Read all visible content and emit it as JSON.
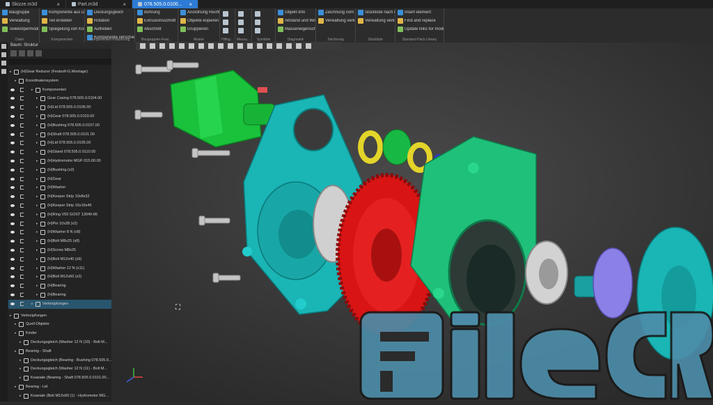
{
  "tabs": [
    {
      "label": "Skizze.m3d",
      "active": false
    },
    {
      "label": "Part.m3d",
      "active": false
    },
    {
      "label": "078.505.0.0100...",
      "active": true
    }
  ],
  "ribbon": {
    "groups": [
      {
        "caption": "Datei",
        "buttons": [
          "Baugruppe",
          "Verwaltung",
          "Teilekörpermodi..."
        ]
      },
      {
        "caption": "Komponenten",
        "buttons": [
          "Komponente aus Datei hinzufügen",
          "Teil erstellen",
          "Spiegelung von Komponenten"
        ]
      },
      {
        "caption": "Komponenten-Platzierung",
        "buttons": [
          "Deckungsgleich",
          "Rotation",
          "Aufheben",
          "Komponente verschieben"
        ]
      },
      {
        "caption": "Baugruppen-Feat...",
        "buttons": [
          "Bohrung",
          "Extrusionsschnitt",
          "Abschnitt"
        ]
      },
      {
        "caption": "Muster",
        "buttons": [
          "Anordnung Rechteckig",
          "Objekte kopieren",
          "Gruppieren"
        ]
      },
      {
        "caption": "Hilfsg...",
        "buttons": []
      },
      {
        "caption": "Messu...",
        "buttons": []
      },
      {
        "caption": "Symbole",
        "buttons": []
      },
      {
        "caption": "Diagnostik",
        "buttons": [
          "Objekt-Info",
          "Abstand und Winkel",
          "Masseneigenschaften"
        ]
      },
      {
        "caption": "Zeichnung",
        "buttons": [
          "Zeichnung vom Modell erstellen",
          "Verwaltung verknüpfter Ze..."
        ]
      },
      {
        "caption": "Stückliste",
        "buttons": [
          "Stückliste nach Dokument erstellen",
          "Verwaltung verknüpfter Stü..."
        ]
      },
      {
        "caption": "Standard Parts Library",
        "buttons": [
          "Insert element",
          "Find and replace",
          "Update links for models"
        ]
      }
    ]
  },
  "panel": {
    "title": "Baum: Struktur",
    "rows": [
      {
        "label": "(H)Gear Reducer (Festsoft-G.Montage)",
        "indent": 0,
        "sel": false
      },
      {
        "label": "Koordinatensystem",
        "indent": 1,
        "sel": false
      },
      {
        "label": "Komponenten",
        "indent": 1,
        "sel": false
      },
      {
        "label": "Gear Casing 078.505.0.0104.00",
        "indent": 2,
        "sel": false
      },
      {
        "label": "(H)Lid 078.505.0.0106.00",
        "indent": 2,
        "sel": false
      },
      {
        "label": "(H)Gear 078.505.0.0103.00",
        "indent": 2,
        "sel": false
      },
      {
        "label": "(H)Bushing 078.505.0.0107.00",
        "indent": 2,
        "sel": false
      },
      {
        "label": "(H)Shaft 078.505.0.0101.00",
        "indent": 2,
        "sel": false
      },
      {
        "label": "(H)Lid 078.505.0.0105.00",
        "indent": 2,
        "sel": false
      },
      {
        "label": "(H)Gland 078.505.0.0110.00",
        "indent": 2,
        "sel": false
      },
      {
        "label": "(H)Hydromotor MGP-315.00.00",
        "indent": 2,
        "sel": false
      },
      {
        "label": "(H)Bushing (x2)",
        "indent": 2,
        "sel": false
      },
      {
        "label": "(H)Gear",
        "indent": 2,
        "sel": false
      },
      {
        "label": "(H)Washer",
        "indent": 2,
        "sel": false
      },
      {
        "label": "(H)Keeper Strip 10x8x32",
        "indent": 2,
        "sel": false
      },
      {
        "label": "(H)Keeper Strip 16x16x45",
        "indent": 2,
        "sel": false
      },
      {
        "label": "(H)Ring V50 GOST 13940-86",
        "indent": 2,
        "sel": false
      },
      {
        "label": "(H)Pin 10x28 (x2)",
        "indent": 2,
        "sel": false
      },
      {
        "label": "(H)Washer 8 N (x8)",
        "indent": 2,
        "sel": false
      },
      {
        "label": "(H)Bolt M8x25 (x8)",
        "indent": 2,
        "sel": false
      },
      {
        "label": "(H)Screw M8x25",
        "indent": 2,
        "sel": false
      },
      {
        "label": "(H)Bolt M12x40 (x9)",
        "indent": 2,
        "sel": false
      },
      {
        "label": "(H)Washer 12 N (x11)",
        "indent": 2,
        "sel": false
      },
      {
        "label": "(H)Bolt M12x60 (x2)",
        "indent": 2,
        "sel": false
      },
      {
        "label": "(H)Bearing",
        "indent": 2,
        "sel": false
      },
      {
        "label": "(H)Bearing",
        "indent": 2,
        "sel": false
      },
      {
        "label": "Verknüpfungen",
        "indent": 1,
        "sel": true
      }
    ],
    "rows2": [
      {
        "label": "Verknüpfungen",
        "indent": 0
      },
      {
        "label": "Quell-Objekte",
        "indent": 1
      },
      {
        "label": "Kinder",
        "indent": 1
      },
      {
        "label": "Deckungsgleich (Washer 12 N (10) - Bolt M...",
        "indent": 2
      },
      {
        "label": "Bearing - Shaft",
        "indent": 1
      },
      {
        "label": "Deckungsgleich (Bearing - Bushing 078.505.0...",
        "indent": 2
      },
      {
        "label": "Deckungsgleich (Washer 12 N (11) - Bolt M...",
        "indent": 2
      },
      {
        "label": "Koaxiale (Bearing - Shaft 078.505.0.0101.00...",
        "indent": 2
      },
      {
        "label": "Bearing - Lid",
        "indent": 1
      },
      {
        "label": "Koaxiale (Bolt M12x60 (1) - Hydromotor MG...",
        "indent": 2
      }
    ]
  },
  "watermark": {
    "text": "FileCR"
  },
  "colors": {
    "accent": "#2d7bd4",
    "green": "#18c23a",
    "cyan": "#1ab5b5",
    "red": "#e01212",
    "teal": "#1fc07a"
  }
}
